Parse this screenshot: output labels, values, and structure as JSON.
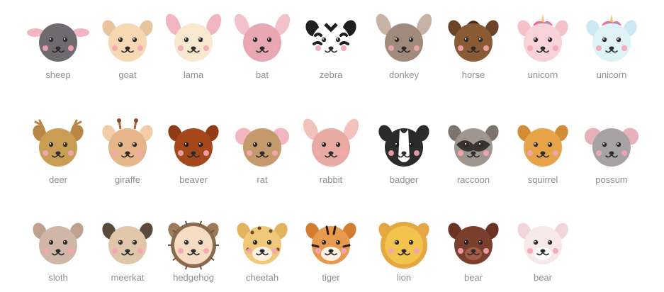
{
  "animals": [
    {
      "id": "sheep",
      "label": "sheep",
      "face": "#6f6a6d",
      "ears": "#f2b6c0",
      "style": "sheep"
    },
    {
      "id": "goat",
      "label": "goat",
      "face": "#f6d9b3",
      "ears": "#e7c49c",
      "style": "goat"
    },
    {
      "id": "lama",
      "label": "lama",
      "face": "#f7e8d0",
      "ears": "#f2b6c0",
      "style": "lama"
    },
    {
      "id": "bat",
      "label": "bat",
      "face": "#e7a8b2",
      "ears": "#f2c2cb",
      "style": "bat"
    },
    {
      "id": "zebra",
      "label": "zebra",
      "face": "#ffffff",
      "ears": "#1f1f1f",
      "style": "zebra"
    },
    {
      "id": "donkey",
      "label": "donkey",
      "face": "#a08a7b",
      "ears": "#c7b3a6",
      "style": "donkey"
    },
    {
      "id": "horse",
      "label": "horse",
      "face": "#8a5a35",
      "ears": "#6c4328",
      "style": "horse"
    },
    {
      "id": "unicorn-pink",
      "label": "unicorn",
      "face": "#f7d2d6",
      "ears": "#f5c1c8",
      "style": "unicorn"
    },
    {
      "id": "unicorn-blue",
      "label": "unicorn",
      "face": "#dff2f8",
      "ears": "#cce9f3",
      "style": "unicorn"
    },
    {
      "id": "deer",
      "label": "deer",
      "face": "#c99d54",
      "ears": "#b88745",
      "style": "deer"
    },
    {
      "id": "giraffe",
      "label": "giraffe",
      "face": "#e6b58a",
      "ears": "#f2cda7",
      "style": "giraffe"
    },
    {
      "id": "beaver",
      "label": "beaver",
      "face": "#a4481b",
      "ears": "#8f3b15",
      "style": "beaver"
    },
    {
      "id": "rat",
      "label": "rat",
      "face": "#c49a6c",
      "ears": "#f2b6c0",
      "style": "rat"
    },
    {
      "id": "rabbit",
      "label": "rabbit",
      "face": "#e9aaa3",
      "ears": "#f2c2bd",
      "style": "rabbit"
    },
    {
      "id": "badger",
      "label": "badger",
      "face": "#2b2b2b",
      "ears": "#2b2b2b",
      "style": "badger"
    },
    {
      "id": "raccoon",
      "label": "raccoon",
      "face": "#a0968e",
      "ears": "#7f746b",
      "style": "raccoon"
    },
    {
      "id": "squirrel",
      "label": "squirrel",
      "face": "#e6a347",
      "ears": "#d18d35",
      "style": "squirrel"
    },
    {
      "id": "possum",
      "label": "possum",
      "face": "#a7a2a3",
      "ears": "#e6b1b8",
      "style": "possum"
    },
    {
      "id": "sloth",
      "label": "sloth",
      "face": "#d0b6a6",
      "ears": "#bea18e",
      "style": "sloth"
    },
    {
      "id": "meerkat",
      "label": "meerkat",
      "face": "#e1c7aa",
      "ears": "#5a4a3c",
      "style": "meerkat"
    },
    {
      "id": "hedgehog",
      "label": "hedgehog",
      "face": "#f4ddc3",
      "ears": "#9c7a5a",
      "style": "hedgehog"
    },
    {
      "id": "cheetah",
      "label": "cheetah",
      "face": "#f0c879",
      "ears": "#e2b460",
      "style": "cheetah"
    },
    {
      "id": "tiger",
      "label": "tiger",
      "face": "#e79a4d",
      "ears": "#d27c2d",
      "style": "tiger"
    },
    {
      "id": "lion",
      "label": "lion",
      "face": "#f2c34d",
      "ears": "#e5a742",
      "style": "lion"
    },
    {
      "id": "bear-brown",
      "label": "bear",
      "face": "#7b3f2e",
      "ears": "#6a3325",
      "style": "bear"
    },
    {
      "id": "bear-polar",
      "label": "bear",
      "face": "#f7e8ea",
      "ears": "#f0d6da",
      "style": "polar"
    }
  ]
}
